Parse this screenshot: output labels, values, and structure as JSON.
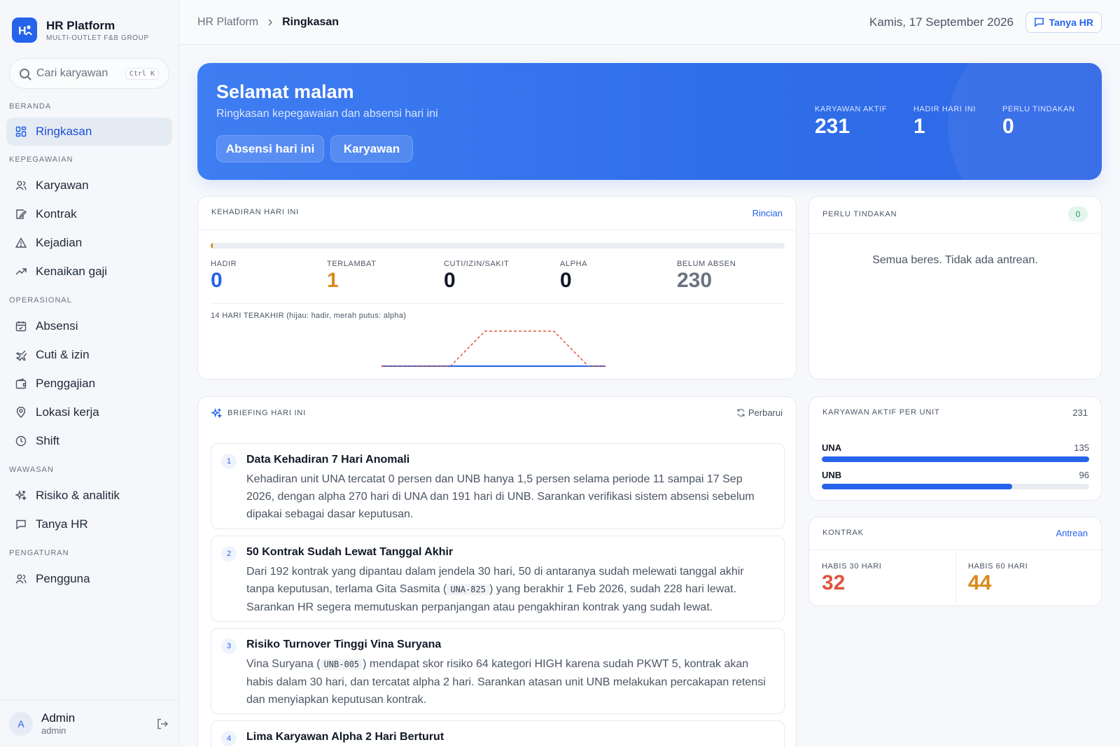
{
  "brand": {
    "logo": "H",
    "name": "HR Platform",
    "subtitle": "MULTI-OUTLET F&B GROUP"
  },
  "search": {
    "placeholder": "Cari karyawan",
    "shortcut": "Ctrl K"
  },
  "nav": {
    "sections": [
      {
        "title": "BERANDA",
        "items": [
          {
            "label": "Ringkasan",
            "icon": "dashboard-icon",
            "active": true
          }
        ]
      },
      {
        "title": "KEPEGAWAIAN",
        "items": [
          {
            "label": "Karyawan",
            "icon": "users-icon"
          },
          {
            "label": "Kontrak",
            "icon": "contract-icon"
          },
          {
            "label": "Kejadian",
            "icon": "warning-icon"
          },
          {
            "label": "Kenaikan gaji",
            "icon": "trending-up-icon"
          }
        ]
      },
      {
        "title": "OPERASIONAL",
        "items": [
          {
            "label": "Absensi",
            "icon": "calendar-icon"
          },
          {
            "label": "Cuti & izin",
            "icon": "plane-icon"
          },
          {
            "label": "Penggajian",
            "icon": "wallet-icon"
          },
          {
            "label": "Lokasi kerja",
            "icon": "map-pin-icon"
          },
          {
            "label": "Shift",
            "icon": "clock-icon"
          }
        ]
      },
      {
        "title": "WAWASAN",
        "items": [
          {
            "label": "Risiko & analitik",
            "icon": "sparkles-icon"
          },
          {
            "label": "Tanya HR",
            "icon": "chat-icon"
          }
        ]
      },
      {
        "title": "PENGATURAN",
        "items": [
          {
            "label": "Pengguna",
            "icon": "users-icon"
          }
        ]
      }
    ]
  },
  "user": {
    "initial": "A",
    "name": "Admin",
    "role": "admin"
  },
  "header": {
    "crumb_root": "HR Platform",
    "crumb_current": "Ringkasan",
    "date": "Kamis, 17 September 2026",
    "ask_label": "Tanya HR"
  },
  "hero": {
    "title": "Selamat malam",
    "subtitle": "Ringkasan kepegawaian dan absensi hari ini",
    "btn_attendance": "Absensi hari ini",
    "btn_employees": "Karyawan",
    "stats": [
      {
        "label": "KARYAWAN AKTIF",
        "value": "231"
      },
      {
        "label": "HADIR HARI INI",
        "value": "1"
      },
      {
        "label": "PERLU TINDAKAN",
        "value": "0"
      }
    ]
  },
  "attendance": {
    "title": "KEHADIRAN HARI INI",
    "link": "Rincian",
    "bar_fraction": 0.004,
    "stats": [
      {
        "label": "HADIR",
        "value": "0",
        "color": "#2563eb"
      },
      {
        "label": "TERLAMBAT",
        "value": "1",
        "color": "#d98a1b"
      },
      {
        "label": "CUTI/IZIN/SAKIT",
        "value": "0",
        "color": "#111827"
      },
      {
        "label": "ALPHA",
        "value": "0",
        "color": "#111827"
      },
      {
        "label": "BELUM ABSEN",
        "value": "230",
        "color": "#6b7280"
      }
    ],
    "trend_label": "14 HARI TERAKHIR (hijau: hadir, merah putus: alpha)"
  },
  "chart_data": {
    "type": "line",
    "x": [
      1,
      2,
      3,
      4,
      5,
      6,
      7,
      8,
      9,
      10,
      11,
      12,
      13,
      14
    ],
    "series": [
      {
        "values": [
          0,
          0,
          0,
          0,
          0,
          0,
          0,
          0,
          0,
          0,
          0,
          0,
          0,
          0
        ],
        "color": "#2563eb",
        "style": "solid"
      },
      {
        "values": [
          0,
          0,
          0,
          0,
          0,
          1,
          2,
          2,
          2,
          2,
          2,
          1,
          0,
          0
        ],
        "color": "#e0533f",
        "style": "dashed"
      }
    ],
    "ylim": [
      0,
      2
    ],
    "grid": false
  },
  "action": {
    "title": "PERLU TINDAKAN",
    "count": "0",
    "empty_text": "Semua beres. Tidak ada antrean."
  },
  "briefing": {
    "title": "BRIEFING HARI INI",
    "refresh": "Perbarui",
    "items": [
      {
        "num": "1",
        "title": "Data Kehadiran 7 Hari Anomali",
        "body": "Kehadiran unit UNA tercatat 0 persen dan UNB hanya 1,5 persen selama periode 11 sampai 17 Sep 2026, dengan alpha 270 hari di UNA dan 191 hari di UNB. Sarankan verifikasi sistem absensi sebelum dipakai sebagai dasar keputusan."
      },
      {
        "num": "2",
        "title": "50 Kontrak Sudah Lewat Tanggal Akhir",
        "body_pre": "Dari 192 kontrak yang dipantau dalam jendela 30 hari, 50 di antaranya sudah melewati tanggal akhir tanpa keputusan, terlama Gita Sasmita (",
        "code": "UNA-825",
        "body_post": ") yang berakhir 1 Feb 2026, sudah 228 hari lewat. Sarankan HR segera memutuskan perpanjangan atau pengakhiran kontrak yang sudah lewat."
      },
      {
        "num": "3",
        "title": "Risiko Turnover Tinggi Vina Suryana",
        "body_pre": "Vina Suryana (",
        "code": "UNB-005",
        "body_post": ") mendapat skor risiko 64 kategori HIGH karena sudah PKWT 5, kontrak akan habis dalam 30 hari, dan tercatat alpha 2 hari. Sarankan atasan unit UNB melakukan percakapan retensi dan menyiapkan keputusan kontrak."
      },
      {
        "num": "4",
        "title": "Lima Karyawan Alpha 2 Hari Berturut"
      }
    ]
  },
  "units": {
    "title": "KARYAWAN AKTIF PER UNIT",
    "total": "231",
    "items": [
      {
        "name": "UNA",
        "count": "135",
        "fraction": 1.0
      },
      {
        "name": "UNB",
        "count": "96",
        "fraction": 0.711
      }
    ]
  },
  "contracts": {
    "title": "KONTRAK",
    "link": "Antrean",
    "stats": [
      {
        "label": "HABIS 30 HARI",
        "value": "32",
        "color": "#e0533f"
      },
      {
        "label": "HABIS 60 HARI",
        "value": "44",
        "color": "#d98a1b"
      }
    ]
  }
}
